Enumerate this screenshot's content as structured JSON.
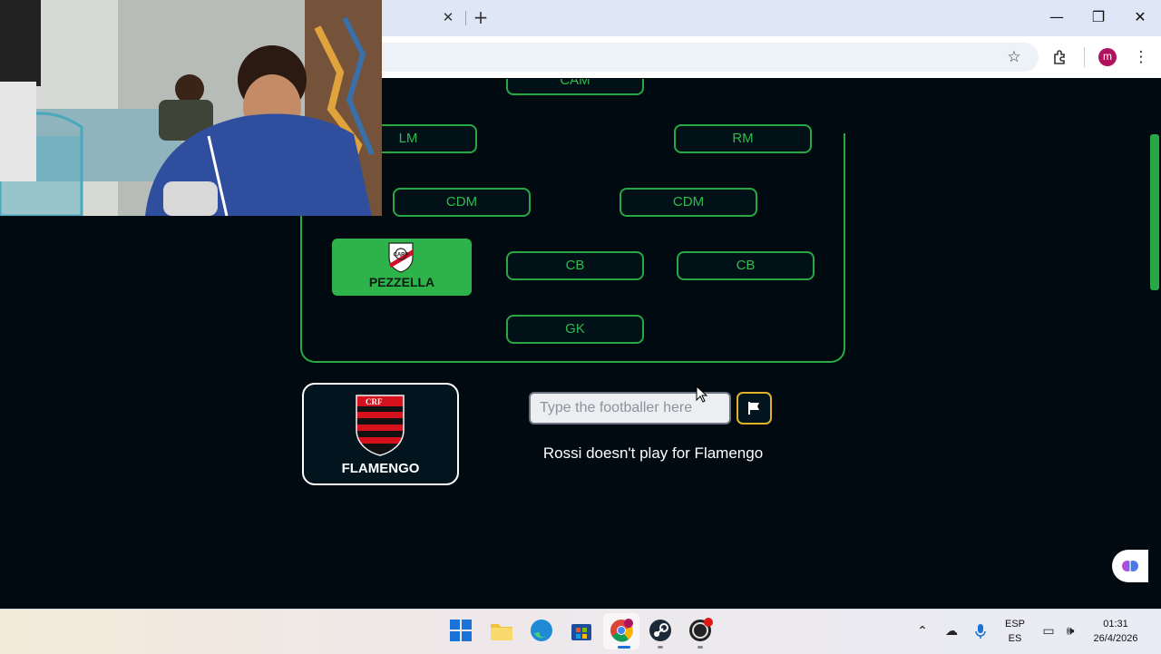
{
  "browser": {
    "tab_close": "✕",
    "new_tab": "+",
    "minimize": "—",
    "restore": "❐",
    "close": "✕",
    "profile_initial": "m"
  },
  "pitch": {
    "positions": {
      "cam": "CAM",
      "lm": "LM",
      "rm": "RM",
      "cdm_left": "CDM",
      "cdm_right": "CDM",
      "cb_center": "CB",
      "cb_right": "CB",
      "gk": "GK"
    },
    "filled_player": {
      "name": "PEZZELLA",
      "club_crest": "river-plate-crest"
    }
  },
  "club": {
    "name": "FLAMENGO",
    "crest": "flamengo-crest"
  },
  "answer_input": {
    "placeholder": "Type the footballer here",
    "value": ""
  },
  "give_up_icon": "flag-icon",
  "message": "Rossi doesn't play for Flamengo",
  "colors": {
    "accent_green": "#27a843",
    "page_bg": "#000a10",
    "flag_button_border": "#e0b22a"
  },
  "taskbar": {
    "language": "ESP",
    "layout": "ES",
    "time": "01:31",
    "date": "26/4/2026"
  }
}
